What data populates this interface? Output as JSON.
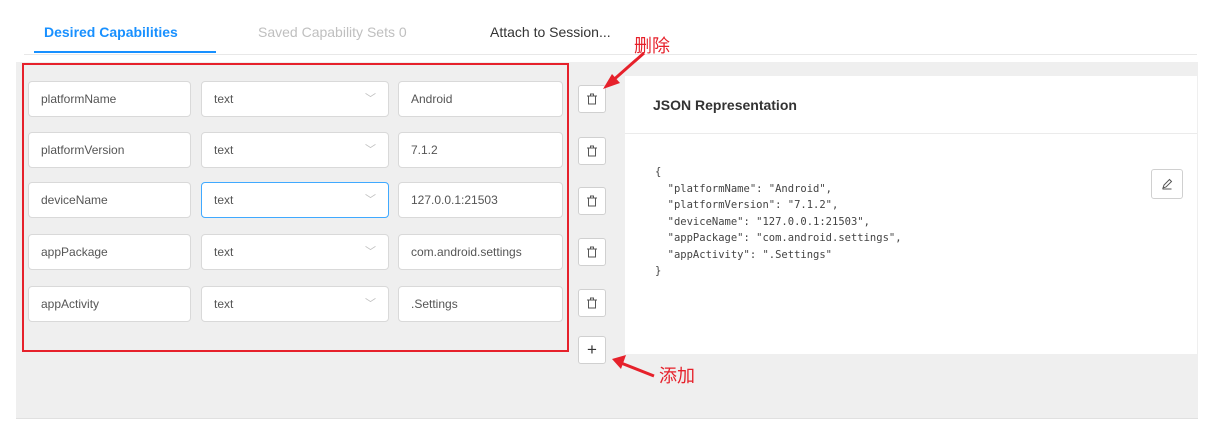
{
  "tabs": [
    {
      "label": "Desired Capabilities",
      "state": "active"
    },
    {
      "label": "Saved Capability Sets 0",
      "state": "disabled"
    },
    {
      "label": "Attach to Session...",
      "state": "normal"
    }
  ],
  "capabilities": [
    {
      "name": "platformName",
      "type": "text",
      "value": "Android"
    },
    {
      "name": "platformVersion",
      "type": "text",
      "value": "7.1.2"
    },
    {
      "name": "deviceName",
      "type": "text",
      "value": "127.0.0.1:21503"
    },
    {
      "name": "appPackage",
      "type": "text",
      "value": "com.android.settings"
    },
    {
      "name": "appActivity",
      "type": "text",
      "value": ".Settings"
    }
  ],
  "add_button_label": "+",
  "json_panel": {
    "title": "JSON Representation",
    "content": "{\n  \"platformName\": \"Android\",\n  \"platformVersion\": \"7.1.2\",\n  \"deviceName\": \"127.0.0.1:21503\",\n  \"appPackage\": \"com.android.settings\",\n  \"appActivity\": \".Settings\"\n}"
  },
  "annotations": {
    "delete_label": "删除",
    "add_label": "添加",
    "color": "#e6212b"
  },
  "colors": {
    "accent": "#1890ff",
    "panel_background": "#efefef"
  },
  "icons": {
    "delete": "trash-icon",
    "add": "plus-icon",
    "edit": "pencil-icon",
    "select": "chevron-down-icon"
  }
}
